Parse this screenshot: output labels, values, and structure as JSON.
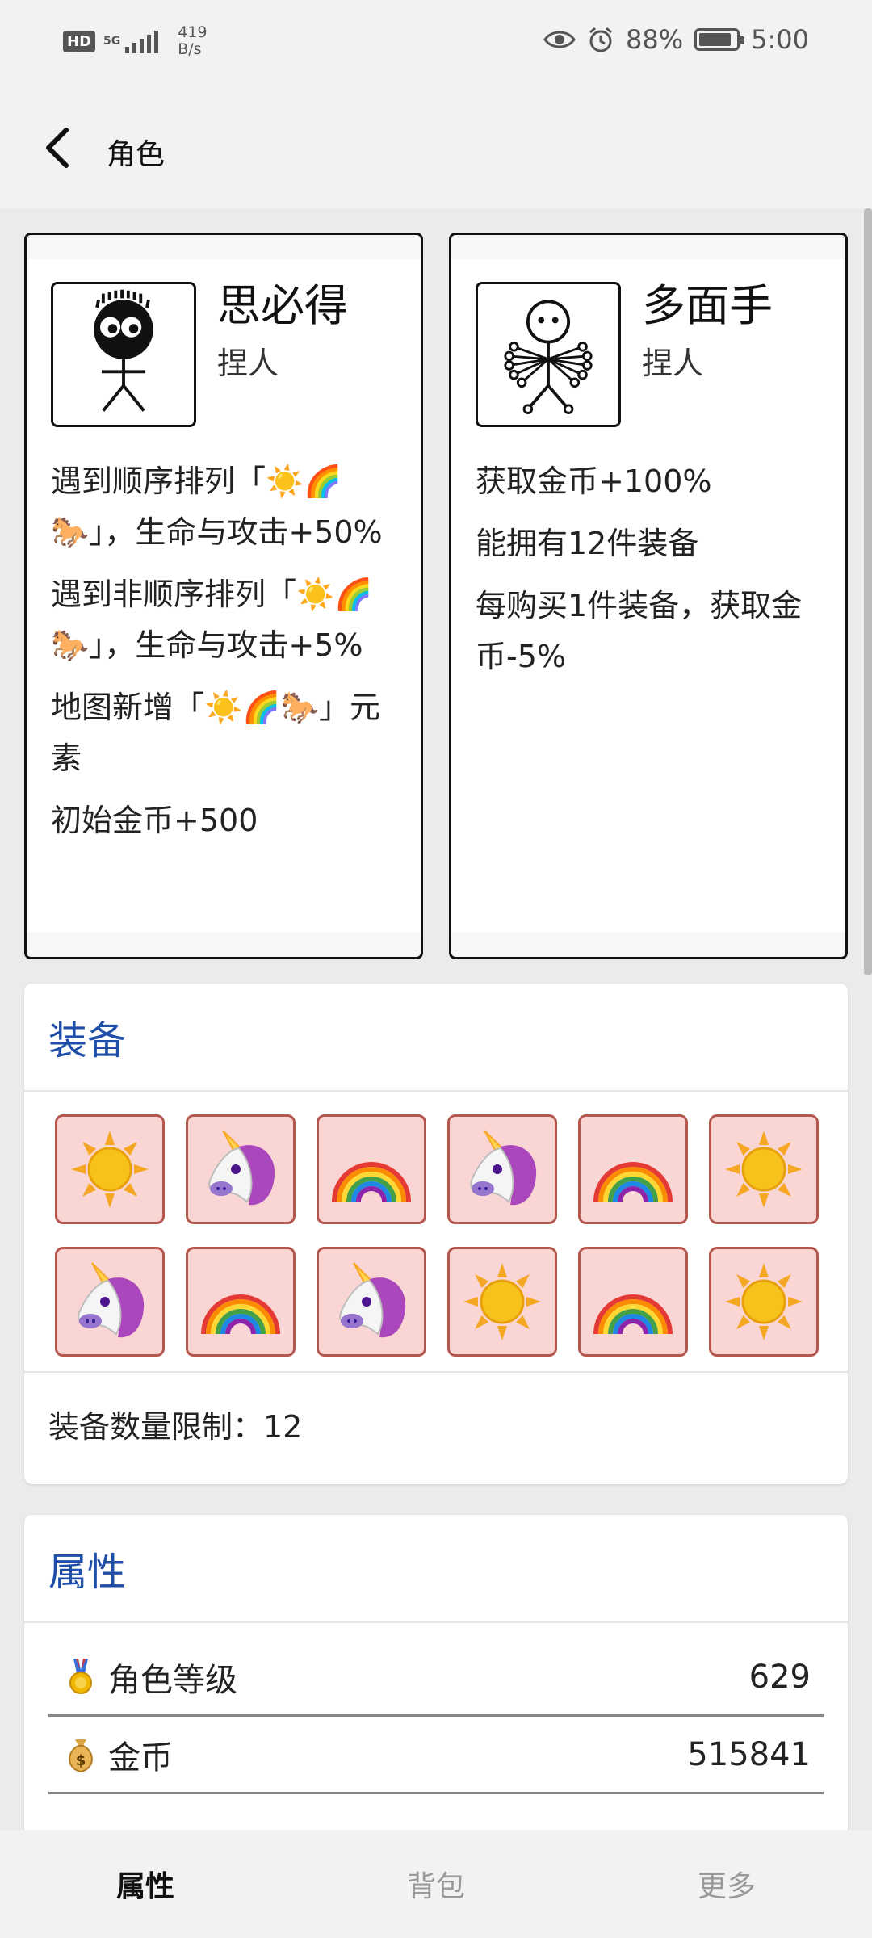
{
  "status_bar": {
    "hd": "HD",
    "network": "5G",
    "speed_value": "419",
    "speed_unit": "B/s",
    "battery": "88%",
    "time": "5:00",
    "battery_level": 0.88
  },
  "header": {
    "title": "角色"
  },
  "characters": [
    {
      "name": "思必得",
      "type": "捏人",
      "traits": [
        "遇到顺序排列「☀️🌈🐎」，生命与攻击+50%",
        "遇到非顺序排列「☀️🌈🐎」，生命与攻击+5%",
        "地图新增「☀️🌈🐎」元素",
        "初始金币+500"
      ]
    },
    {
      "name": "多面手",
      "type": "捏人",
      "traits": [
        "获取金币+100%",
        "能拥有12件装备",
        "每购买1件装备，获取金币-5%"
      ]
    }
  ],
  "equipment": {
    "title": "装备",
    "items": [
      "sun",
      "unicorn",
      "rainbow",
      "unicorn",
      "rainbow",
      "sun",
      "unicorn",
      "rainbow",
      "unicorn",
      "sun",
      "rainbow",
      "sun"
    ],
    "limit_label": "装备数量限制：12"
  },
  "attributes": {
    "title": "属性",
    "rows": [
      {
        "icon": "medal-icon",
        "label": "角色等级",
        "value": "629"
      },
      {
        "icon": "money-bag-icon",
        "label": "金币",
        "value": "515841"
      }
    ]
  },
  "tabs": [
    {
      "label": "属性",
      "active": true
    },
    {
      "label": "背包",
      "active": false
    },
    {
      "label": "更多",
      "active": false
    }
  ]
}
